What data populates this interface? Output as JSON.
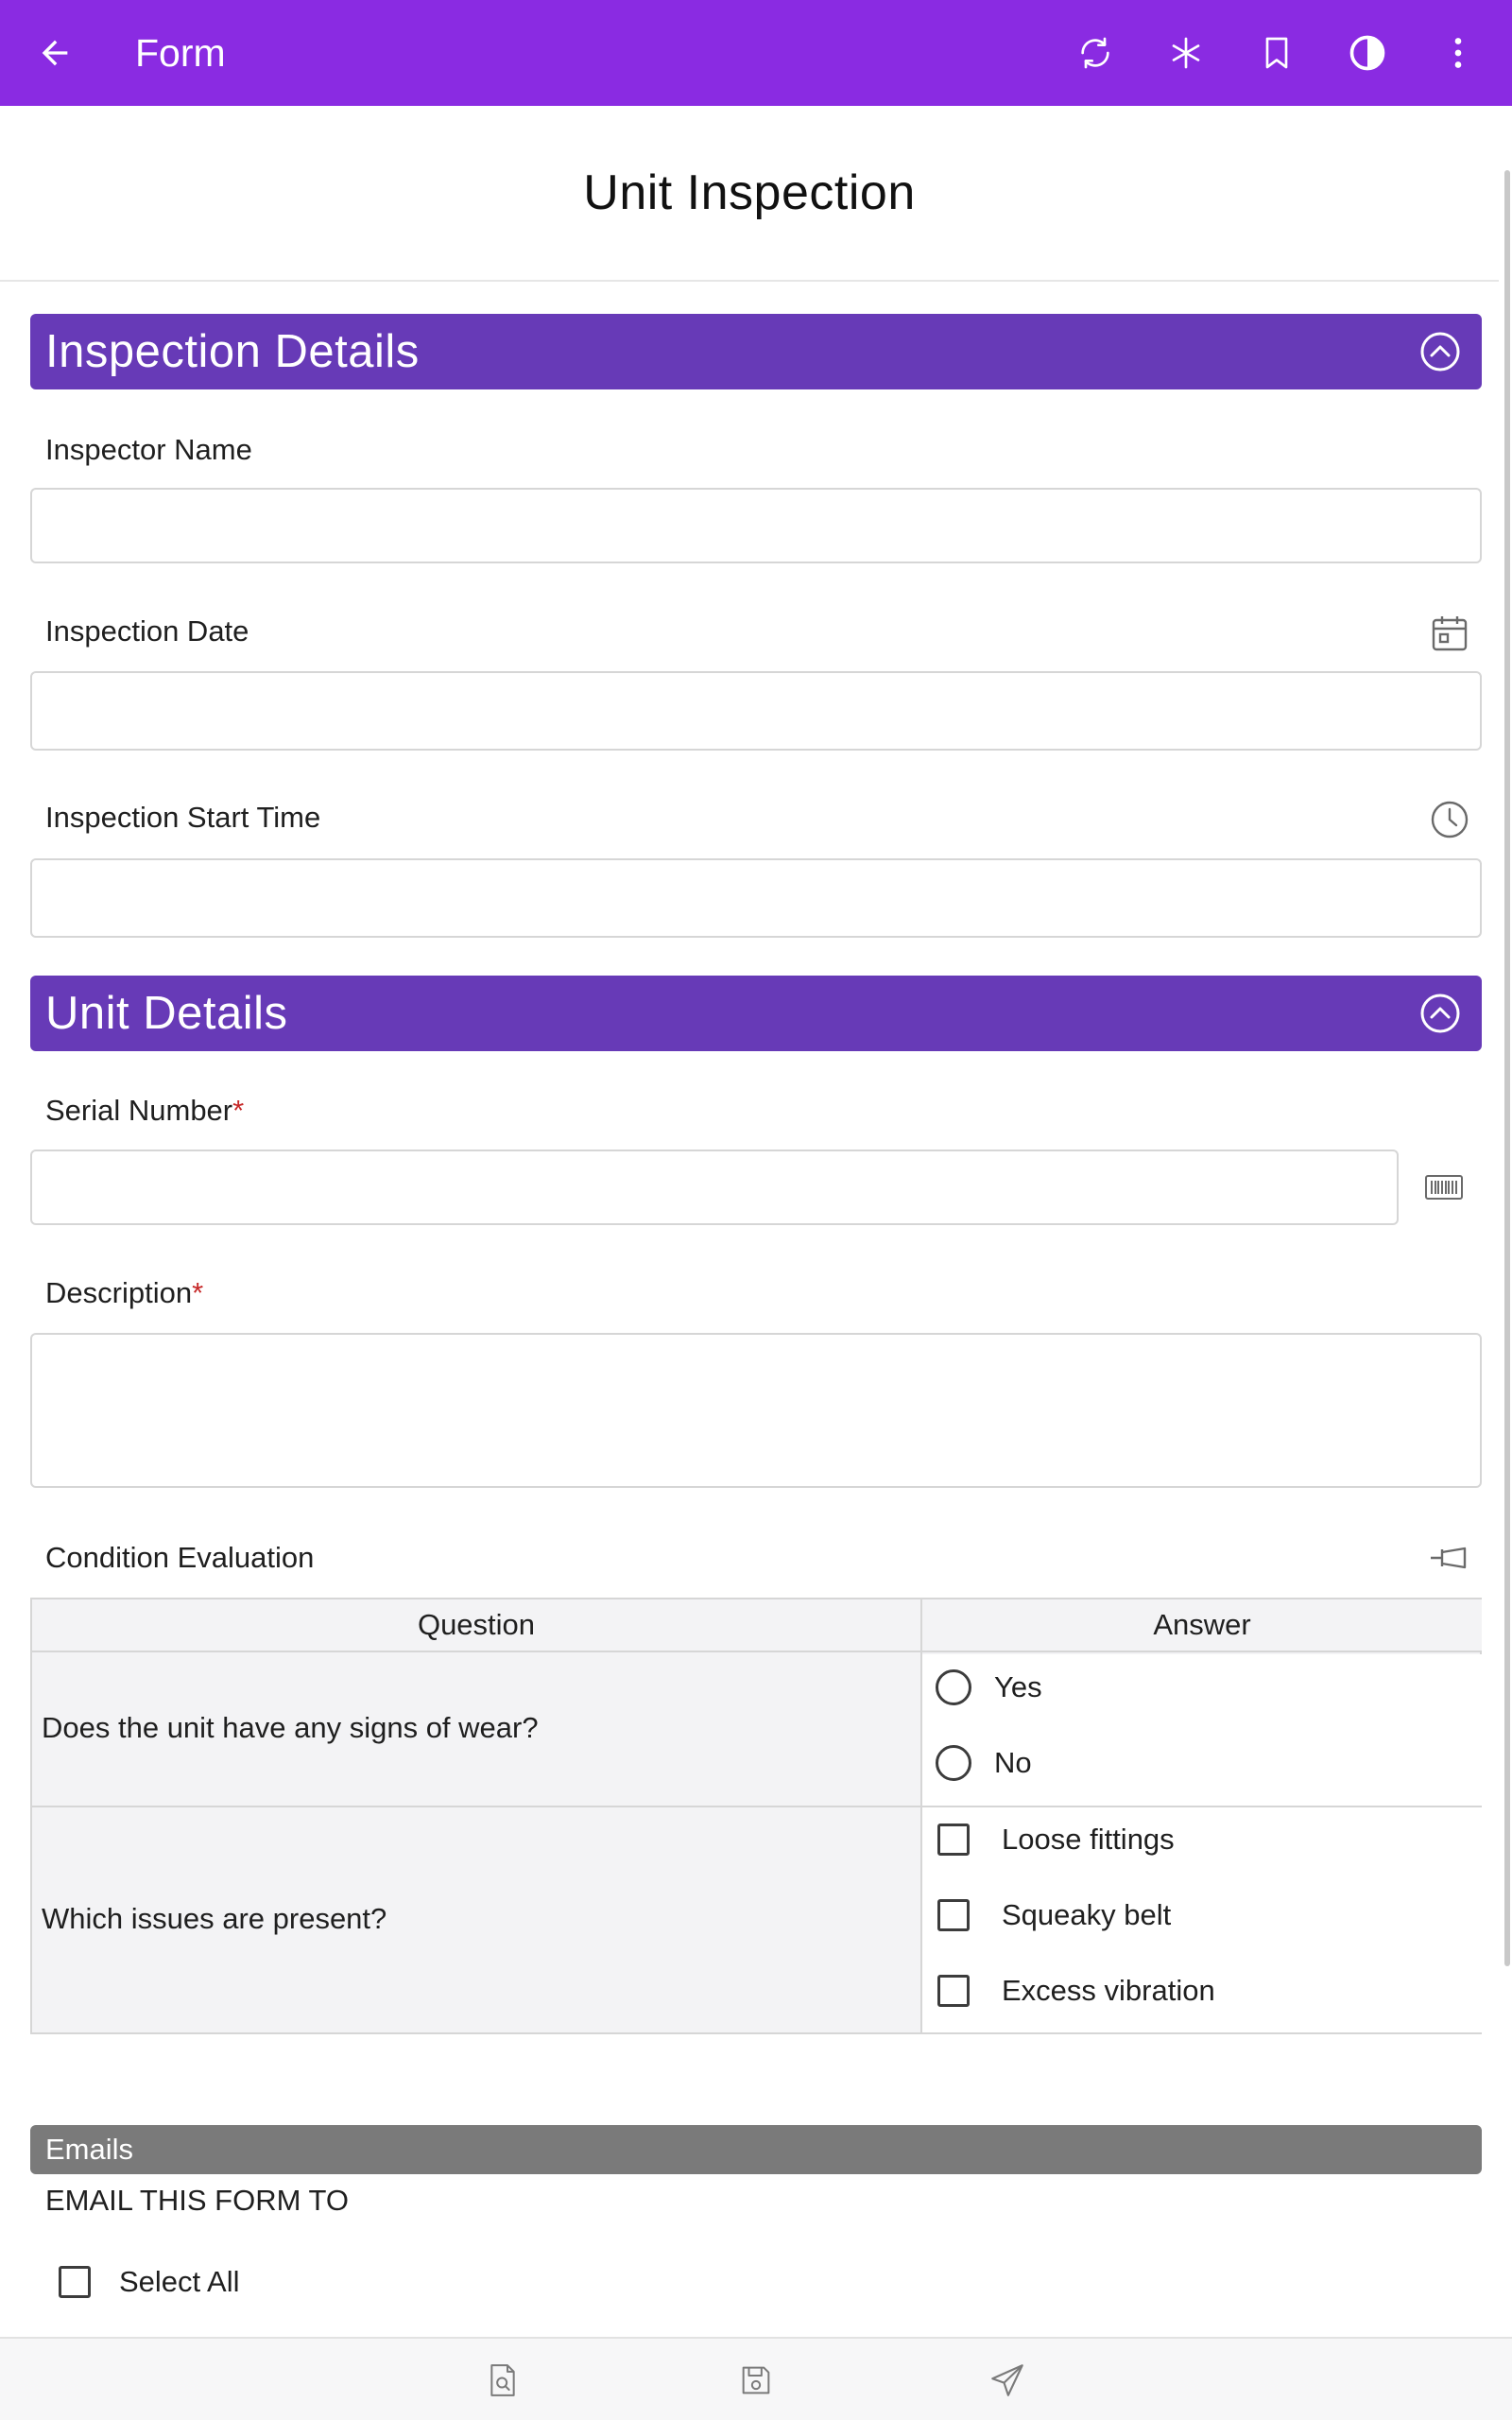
{
  "appbar": {
    "title": "Form",
    "actions": [
      "sync-icon",
      "asterisk-icon",
      "bookmark-icon",
      "contrast-icon",
      "more-vert-icon"
    ]
  },
  "page": {
    "title": "Unit Inspection"
  },
  "sections": {
    "inspection": {
      "title": "Inspection Details"
    },
    "unit": {
      "title": "Unit Details"
    }
  },
  "fields": {
    "inspector_name": {
      "label": "Inspector Name",
      "value": ""
    },
    "inspection_date": {
      "label": "Inspection Date",
      "value": ""
    },
    "inspection_start_time": {
      "label": "Inspection Start Time",
      "value": ""
    },
    "serial_number": {
      "label": "Serial Number",
      "required_mark": "*",
      "value": ""
    },
    "description": {
      "label": "Description",
      "required_mark": "*",
      "value": ""
    },
    "condition_evaluation": {
      "label": "Condition Evaluation"
    }
  },
  "grid": {
    "headers": {
      "question": "Question",
      "answer": "Answer"
    },
    "rows": [
      {
        "question": "Does the unit have any signs of wear?",
        "options": [
          "Yes",
          "No"
        ],
        "type": "radio"
      },
      {
        "question": "Which issues are present?",
        "options": [
          "Loose fittings",
          "Squeaky belt",
          "Excess vibration"
        ],
        "type": "checkbox"
      }
    ]
  },
  "emails": {
    "section_title": "Emails",
    "email_to_label": "EMAIL THIS FORM TO",
    "select_all_label": "Select All"
  },
  "bottom_bar": {
    "actions": [
      "preview-icon",
      "save-icon",
      "send-icon"
    ]
  },
  "colors": {
    "appbar": "#8a2be2",
    "section": "#673ab7",
    "emails_bar": "#7a7a7a",
    "required": "#c62828"
  }
}
